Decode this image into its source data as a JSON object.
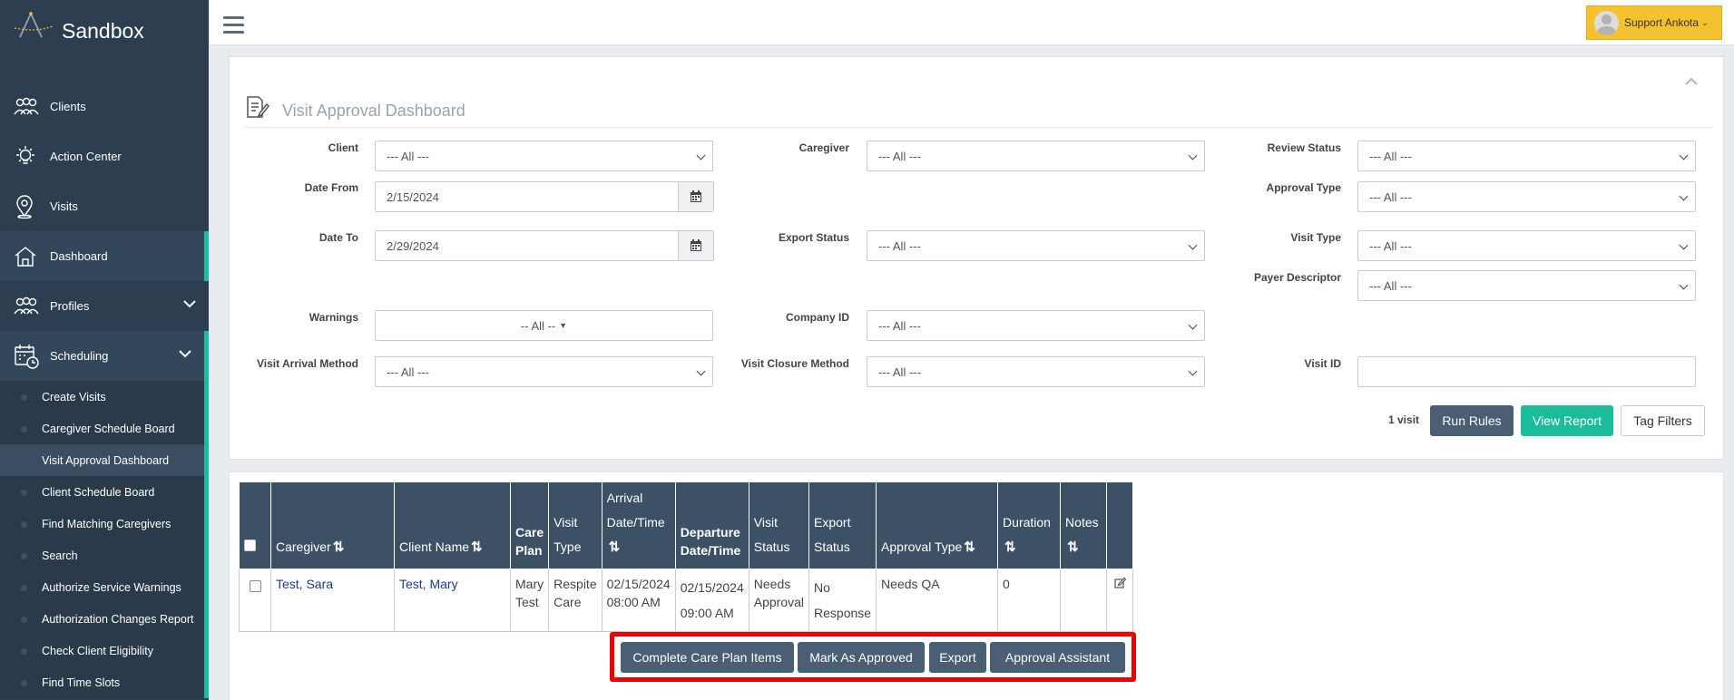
{
  "brand": {
    "name": "Sandbox"
  },
  "sidebar": {
    "items": [
      {
        "label": "Clients",
        "icon": "clients-icon"
      },
      {
        "label": "Action Center",
        "icon": "lightbulb-icon"
      },
      {
        "label": "Visits",
        "icon": "map-pin-icon"
      },
      {
        "label": "Dashboard",
        "icon": "home-icon"
      },
      {
        "label": "Profiles",
        "icon": "users-icon"
      },
      {
        "label": "Scheduling",
        "icon": "calendar-clock-icon"
      }
    ],
    "subitems": [
      "Create Visits",
      "Caregiver Schedule Board",
      "Visit Approval Dashboard",
      "Client Schedule Board",
      "Find Matching Caregivers",
      "Search",
      "Authorize Service Warnings",
      "Authorization Changes Report",
      "Check Client Eligibility",
      "Find Time Slots"
    ]
  },
  "header": {
    "user": "Support Ankota"
  },
  "panel": {
    "title": "Visit Approval Dashboard"
  },
  "filters": {
    "client": {
      "label": "Client",
      "value": "--- All ---"
    },
    "caregiver": {
      "label": "Caregiver",
      "value": "--- All ---"
    },
    "review_status": {
      "label": "Review Status",
      "value": "--- All ---"
    },
    "date_from": {
      "label": "Date From",
      "value": "2/15/2024"
    },
    "approval_type": {
      "label": "Approval Type",
      "value": "--- All ---"
    },
    "date_to": {
      "label": "Date To",
      "value": "2/29/2024"
    },
    "export_status": {
      "label": "Export Status",
      "value": "--- All ---"
    },
    "visit_type": {
      "label": "Visit Type",
      "value": "--- All ---"
    },
    "payer_descriptor": {
      "label": "Payer Descriptor",
      "value": "--- All ---"
    },
    "warnings": {
      "label": "Warnings",
      "value": "-- All --"
    },
    "company_id": {
      "label": "Company ID",
      "value": "--- All ---"
    },
    "visit_arrival_method": {
      "label": "Visit Arrival Method",
      "value": "--- All ---"
    },
    "visit_closure_method": {
      "label": "Visit Closure Method",
      "value": "--- All ---"
    },
    "visit_id": {
      "label": "Visit ID",
      "value": ""
    }
  },
  "result_count": "1 visit",
  "buttons": {
    "run_rules": "Run Rules",
    "view_report": "View Report",
    "tag_filters": "Tag Filters"
  },
  "table": {
    "headers": {
      "caregiver": "Caregiver",
      "client_name": "Client Name",
      "care_plan": "Care Plan",
      "visit_type": "Visit Type",
      "arrival": "Arrival Date/Time",
      "departure": "Departure Date/Time",
      "visit_status": "Visit Status",
      "export_status": "Export Status",
      "approval_type": "Approval Type",
      "duration": "Duration",
      "notes": "Notes"
    },
    "rows": [
      {
        "caregiver": "Test, Sara",
        "client_name": "Test, Mary",
        "care_plan": "Mary Test",
        "visit_type": "Respite Care",
        "arrival": "02/15/2024 08:00 AM",
        "departure": "02/15/2024 09:00 AM",
        "visit_status": "Needs Approval",
        "export_status": "No Response",
        "approval_type": "Needs QA",
        "duration": "0",
        "notes": ""
      }
    ]
  },
  "actions": {
    "complete_care_plan": "Complete Care Plan Items",
    "mark_approved": "Mark As Approved",
    "export": "Export",
    "approval_assistant": "Approval Assistant"
  },
  "colors": {
    "sidebar": "#2d3e50",
    "accent": "#1abc9c",
    "table_header": "#3d5166",
    "user_button": "#f3c22e",
    "highlight": "#ee0000"
  }
}
